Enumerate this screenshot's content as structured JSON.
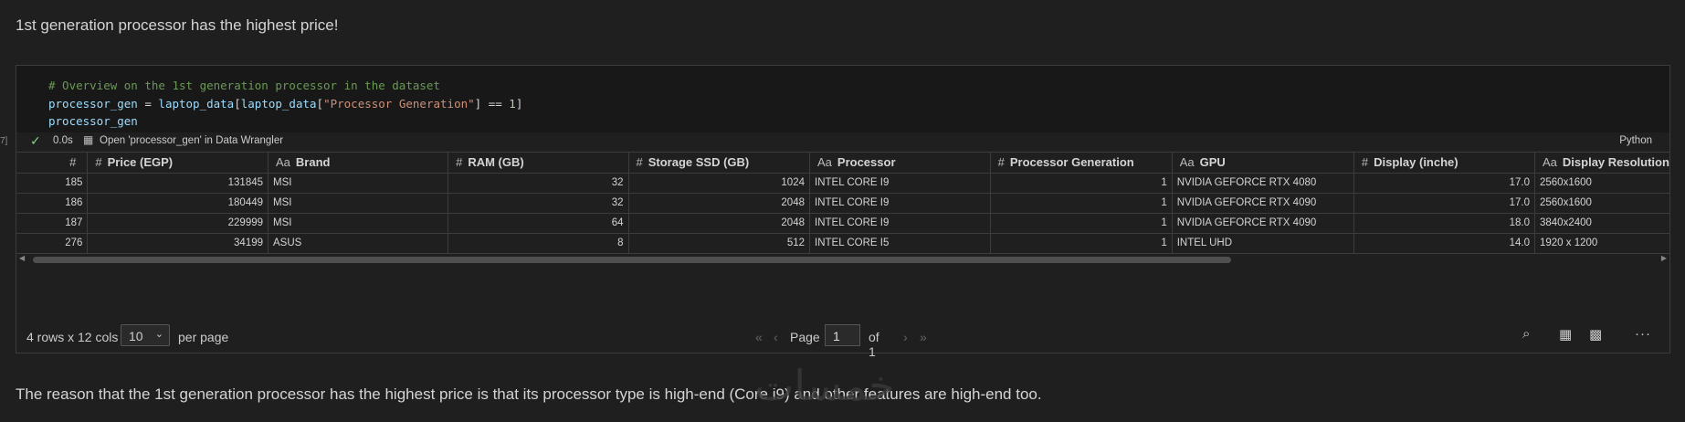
{
  "markdown": {
    "top": "1st generation processor has the highest price!",
    "bottom": "The reason that the 1st generation processor has the highest price is that its processor type is high-end (Core i9) and other features are high-end too."
  },
  "code": {
    "comment": "# Overview on the 1st generation processor in the dataset",
    "line2_var": "processor_gen",
    "line2_op": " = ",
    "line2_df": "laptop_data",
    "line2_br1": "[",
    "line2_df2": "laptop_data",
    "line2_br2": "[",
    "line2_str": "\"Processor Generation\"",
    "line2_br3": "] == ",
    "line2_num": "1",
    "line2_br4": "]",
    "line3": "processor_gen"
  },
  "execution": {
    "count": "7]",
    "time": "0.0s",
    "wrangler_link": "Open 'processor_gen' in Data Wrangler",
    "language": "Python"
  },
  "grid": {
    "columns": [
      {
        "type": "#",
        "label": ""
      },
      {
        "type": "#",
        "label": "Price (EGP)"
      },
      {
        "type": "Aa",
        "label": "Brand"
      },
      {
        "type": "#",
        "label": "RAM (GB)"
      },
      {
        "type": "#",
        "label": "Storage SSD (GB)"
      },
      {
        "type": "Aa",
        "label": "Processor"
      },
      {
        "type": "#",
        "label": "Processor Generation"
      },
      {
        "type": "Aa",
        "label": "GPU"
      },
      {
        "type": "#",
        "label": "Display (inche)"
      },
      {
        "type": "Aa",
        "label": "Display Resolution"
      }
    ],
    "rows": [
      [
        "185",
        "131845",
        "MSI",
        "32",
        "1024",
        "INTEL CORE I9",
        "1",
        "NVIDIA GEFORCE RTX 4080",
        "17.0",
        "2560x1600"
      ],
      [
        "186",
        "180449",
        "MSI",
        "32",
        "2048",
        "INTEL CORE I9",
        "1",
        "NVIDIA GEFORCE RTX 4090",
        "17.0",
        "2560x1600"
      ],
      [
        "187",
        "229999",
        "MSI",
        "64",
        "2048",
        "INTEL CORE I9",
        "1",
        "NVIDIA GEFORCE RTX 4090",
        "18.0",
        "3840x2400"
      ],
      [
        "276",
        "34199",
        "ASUS",
        "8",
        "512",
        "INTEL CORE I5",
        "1",
        "INTEL UHD",
        "14.0",
        "1920 x 1200"
      ]
    ]
  },
  "footer": {
    "summary": "4 rows x 12 cols",
    "page_size": "10",
    "per_page": "per page",
    "page_label": "Page",
    "page_value": "1",
    "of_label": "of 1"
  },
  "icons": {
    "check": "check-icon",
    "search": "search-icon",
    "table": "table-icon",
    "wrangler": "data-wrangler-icon",
    "more": "more-icon"
  },
  "watermark": "خمسات"
}
